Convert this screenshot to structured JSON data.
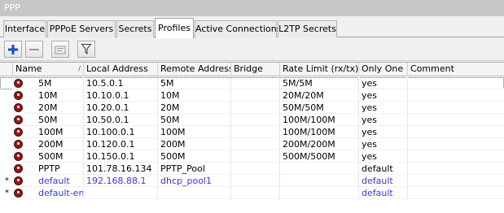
{
  "window": {
    "title": "PPP"
  },
  "tabs": [
    {
      "label": "Interface"
    },
    {
      "label": "PPPoE Servers"
    },
    {
      "label": "Secrets"
    },
    {
      "label": "Profiles",
      "active": true
    },
    {
      "label": "Active Connections"
    },
    {
      "label": "L2TP Secrets"
    }
  ],
  "toolbar": {
    "buttons": [
      "add-icon",
      "remove-icon",
      "copy-comment-icon",
      "filter-icon"
    ],
    "add_color": "#1a4fb0"
  },
  "table": {
    "columns": [
      "Name",
      "Local Address",
      "Remote Address",
      "Bridge",
      "Rate Limit (rx/tx)",
      "Only One",
      "Comment"
    ],
    "sort_indicator": "/",
    "rows": [
      {
        "marker": "",
        "name": "5M",
        "local": "10.5.0.1",
        "remote": "5M",
        "bridge": "",
        "rate": "5M/5M",
        "only_one": "yes",
        "comment": ""
      },
      {
        "marker": "",
        "name": "10M",
        "local": "10.10.0.1",
        "remote": "10M",
        "bridge": "",
        "rate": "20M/20M",
        "only_one": "yes",
        "comment": ""
      },
      {
        "marker": "",
        "name": "20M",
        "local": "10.20.0.1",
        "remote": "20M",
        "bridge": "",
        "rate": "50M/50M",
        "only_one": "yes",
        "comment": ""
      },
      {
        "marker": "",
        "name": "50M",
        "local": "10.50.0.1",
        "remote": "50M",
        "bridge": "",
        "rate": "100M/100M",
        "only_one": "yes",
        "comment": ""
      },
      {
        "marker": "",
        "name": "100M",
        "local": "10.100.0.1",
        "remote": "100M",
        "bridge": "",
        "rate": "100M/100M",
        "only_one": "yes",
        "comment": ""
      },
      {
        "marker": "",
        "name": "200M",
        "local": "10.120.0.1",
        "remote": "200M",
        "bridge": "",
        "rate": "200M/200M",
        "only_one": "yes",
        "comment": ""
      },
      {
        "marker": "",
        "name": "500M",
        "local": "10.150.0.1",
        "remote": "500M",
        "bridge": "",
        "rate": "500M/500M",
        "only_one": "yes",
        "comment": ""
      },
      {
        "marker": "",
        "name": "PPTP",
        "local": "101.78.16.134",
        "remote": "PPTP_Pool",
        "bridge": "",
        "rate": "",
        "only_one": "default",
        "comment": ""
      },
      {
        "marker": "*",
        "name": "default",
        "local": "192.168.88.1",
        "remote": "dhcp_pool1",
        "bridge": "",
        "rate": "",
        "only_one": "default",
        "comment": ""
      },
      {
        "marker": "*",
        "name": "default-encr...",
        "local": "",
        "remote": "",
        "bridge": "",
        "rate": "",
        "only_one": "default",
        "comment": ""
      }
    ]
  }
}
